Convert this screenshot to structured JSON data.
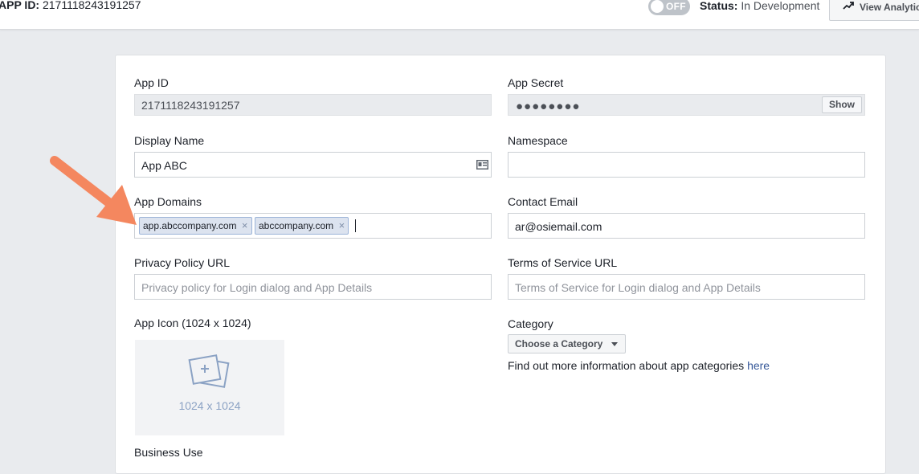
{
  "header": {
    "app_id_label": "APP ID:",
    "app_id_value": "2171118243191257",
    "toggle_label": "OFF",
    "status_label": "Status:",
    "status_value": "In Development",
    "analytics_label": "View Analytics",
    "analytics_icon": "trending-up-icon"
  },
  "form": {
    "app_id": {
      "label": "App ID",
      "value": "2171118243191257"
    },
    "app_secret": {
      "label": "App Secret",
      "masked": "●●●●●●●●",
      "show_label": "Show"
    },
    "display_name": {
      "label": "Display Name",
      "value": "App ABC",
      "icon": "contact-card-icon"
    },
    "namespace": {
      "label": "Namespace",
      "value": ""
    },
    "app_domains": {
      "label": "App Domains",
      "tokens": [
        "app.abccompany.com",
        "abccompany.com"
      ],
      "remove_glyph": "×"
    },
    "contact_email": {
      "label": "Contact Email",
      "value": "ar@osiemail.com"
    },
    "privacy_url": {
      "label": "Privacy Policy URL",
      "placeholder": "Privacy policy for Login dialog and App Details"
    },
    "tos_url": {
      "label": "Terms of Service URL",
      "placeholder": "Terms of Service for Login dialog and App Details"
    },
    "app_icon": {
      "label": "App Icon (1024 x 1024)",
      "dimensions": "1024 x 1024"
    },
    "category": {
      "label": "Category",
      "button_label": "Choose a Category",
      "info_text": "Find out more information about app categories",
      "info_link": "here"
    },
    "business_use": {
      "label": "Business Use"
    }
  },
  "colors": {
    "annotation_arrow": "#f4875f",
    "link": "#365899",
    "token_bg": "#dce3ef"
  }
}
